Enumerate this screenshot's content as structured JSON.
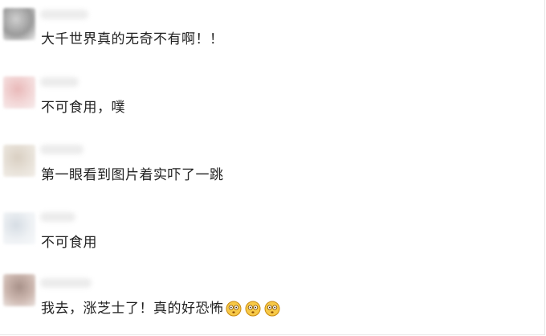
{
  "comments": [
    {
      "text": "大千世界真的无奇不有啊！！",
      "avatar": {
        "colors": [
          "#9a9a9a",
          "#cfcfcf",
          "#efefef"
        ]
      },
      "emojis": []
    },
    {
      "text": "不可食用，噗",
      "avatar": {
        "colors": [
          "#f3d8d8",
          "#e9b9b9",
          "#f7eded"
        ]
      },
      "emojis": []
    },
    {
      "text": "第一眼看到图片着实吓了一跳",
      "avatar": {
        "colors": [
          "#e8e2d9",
          "#d9cfc2",
          "#f3efe9"
        ]
      },
      "emojis": []
    },
    {
      "text": "不可食用",
      "avatar": {
        "colors": [
          "#eef1f4",
          "#d6dde4",
          "#f7f9fb"
        ]
      },
      "emojis": []
    },
    {
      "text": "我去，涨芝士了！真的好恐怖",
      "avatar": {
        "colors": [
          "#cdb8b0",
          "#a89189",
          "#ebe2de"
        ]
      },
      "emojis": [
        "frightened-face-icon",
        "frightened-face-icon",
        "frightened-face-icon"
      ]
    }
  ],
  "colors": {
    "text": "#222222",
    "emoji_face": "#f7c948",
    "emoji_outline": "#c98a10"
  }
}
